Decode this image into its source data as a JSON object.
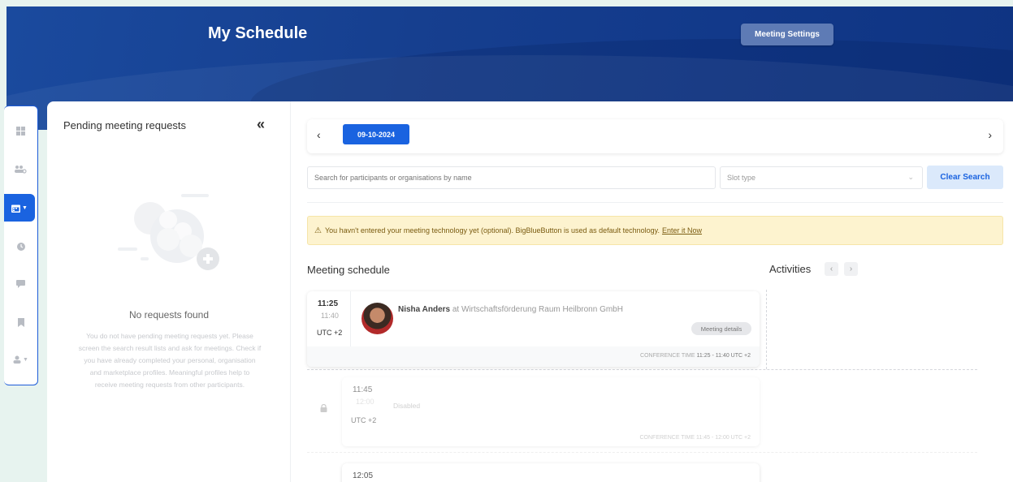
{
  "header": {
    "title": "My Schedule",
    "meeting_settings_label": "Meeting Settings"
  },
  "sidenav": {
    "items": [
      {
        "icon": "dashboard-icon"
      },
      {
        "icon": "people-search-icon"
      },
      {
        "icon": "calendar-icon",
        "active": true
      },
      {
        "icon": "clock-icon"
      },
      {
        "icon": "chat-icon"
      },
      {
        "icon": "bookmark-icon"
      },
      {
        "icon": "user-icon"
      }
    ]
  },
  "pending": {
    "title": "Pending meeting requests",
    "collapse_glyph": "«",
    "empty_title": "No requests found",
    "empty_text": "You do not have pending meeting requests yet. Please screen the search result lists and ask for meetings. Check if you have already completed your personal, organisation and marketplace profiles. Meaningful profiles help to receive meeting requests from other participants."
  },
  "date_bar": {
    "current_date": "09-10-2024",
    "prev_glyph": "‹",
    "next_glyph": "›"
  },
  "search": {
    "placeholder": "Search for participants or organisations by name",
    "slot_type_placeholder": "Slot type",
    "clear_label": "Clear Search"
  },
  "warning": {
    "icon": "⚠",
    "text": "You havn't entered your meeting technology yet (optional). BigBlueButton is used as default technology.",
    "link": "Enter it Now"
  },
  "schedule": {
    "title": "Meeting schedule",
    "activities_title": "Activities",
    "meetings": [
      {
        "start": "11:25",
        "end": "11:40",
        "tz": "UTC +2",
        "participant": "Nisha Anders",
        "org_prefix": "at",
        "org": "Wirtschaftsförderung Raum Heilbronn GmbH",
        "details_label": "Meeting details",
        "conf_label": "CONFERENCE TIME",
        "conf_time": "11:25 - 11:40 UTC +2"
      },
      {
        "start": "11:45",
        "end": "12:00",
        "tz": "UTC +2",
        "status": "Disabled",
        "conf_label": "CONFERENCE TIME",
        "conf_time": "11:45 - 12:00 UTC +2"
      },
      {
        "start": "12:05"
      }
    ]
  },
  "colors": {
    "brand_blue": "#1a63e0",
    "banner": "#163f8f",
    "warning_bg": "#fdf3cf"
  }
}
